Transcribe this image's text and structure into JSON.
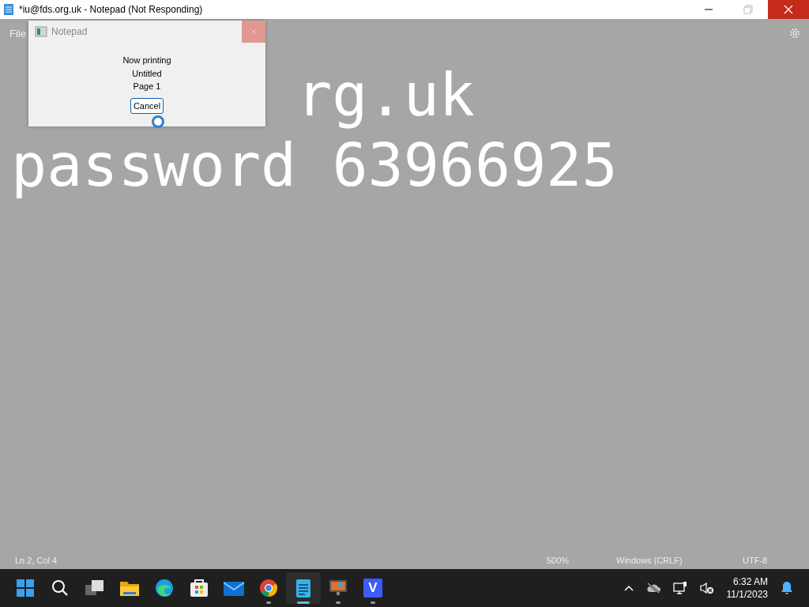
{
  "window": {
    "title": "*iu@fds.org.uk - Notepad (Not Responding)"
  },
  "menu": [
    "File"
  ],
  "editor": {
    "line_1_visible": "rg.uk",
    "line_2": "password 63966925"
  },
  "dialog": {
    "title": "Notepad",
    "lines": [
      "Now printing",
      "Untitled",
      "Page 1"
    ],
    "button": "Cancel"
  },
  "status_bar": {
    "position": "Ln 2, Col 4",
    "zoom": "500%",
    "line_ending": "Windows (CRLF)",
    "encoding": "UTF-8"
  },
  "taskbar": {
    "apps": [
      {
        "kind": "start",
        "running": false,
        "selected": false
      },
      {
        "kind": "search",
        "running": false,
        "selected": false
      },
      {
        "kind": "taskview",
        "running": false,
        "selected": false
      },
      {
        "kind": "folder",
        "running": false,
        "selected": false
      },
      {
        "kind": "edge",
        "running": false,
        "selected": false
      },
      {
        "kind": "store",
        "running": false,
        "selected": false
      },
      {
        "kind": "mail",
        "running": false,
        "selected": false
      },
      {
        "kind": "chrome",
        "running": true,
        "selected": false
      },
      {
        "kind": "notepad",
        "running": true,
        "selected": true
      },
      {
        "kind": "monitor",
        "running": true,
        "selected": false
      },
      {
        "kind": "v",
        "running": true,
        "selected": false
      }
    ],
    "v_letter": "V",
    "time": "6:32 AM",
    "date": "11/1/2023"
  }
}
